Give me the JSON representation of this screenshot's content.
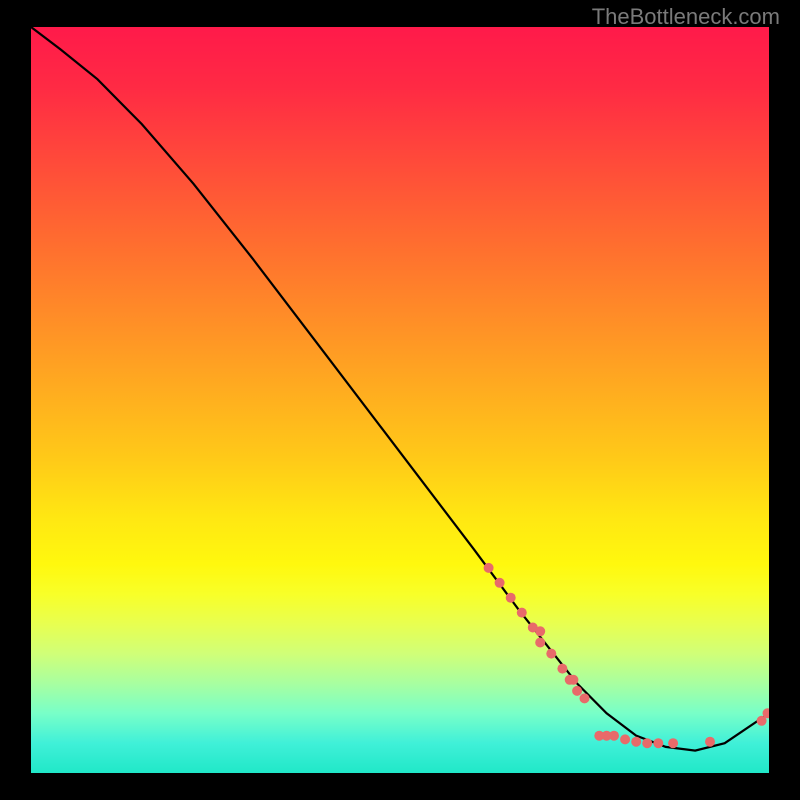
{
  "watermark": "TheBottleneck.com",
  "chart_data": {
    "type": "line",
    "title": "",
    "xlabel": "",
    "ylabel": "",
    "xlim": [
      0,
      100
    ],
    "ylim": [
      0,
      100
    ],
    "grid": false,
    "legend": false,
    "series": [
      {
        "name": "curve",
        "x": [
          0,
          4,
          9,
          15,
          22,
          30,
          40,
          50,
          60,
          66,
          70,
          74,
          78,
          82,
          86,
          90,
          94,
          100
        ],
        "y": [
          100,
          97,
          93,
          87,
          79,
          69,
          56,
          43,
          30,
          22,
          17,
          12,
          8,
          5,
          3.5,
          3,
          4,
          8
        ]
      }
    ],
    "markers": [
      {
        "x": 62.0,
        "y": 27.5
      },
      {
        "x": 63.5,
        "y": 25.5
      },
      {
        "x": 65.0,
        "y": 23.5
      },
      {
        "x": 66.5,
        "y": 21.5
      },
      {
        "x": 68.0,
        "y": 19.5
      },
      {
        "x": 69.0,
        "y": 19.0
      },
      {
        "x": 69.0,
        "y": 17.5
      },
      {
        "x": 70.5,
        "y": 16.0
      },
      {
        "x": 72.0,
        "y": 14.0
      },
      {
        "x": 73.0,
        "y": 12.5
      },
      {
        "x": 73.5,
        "y": 12.5
      },
      {
        "x": 74.0,
        "y": 11.0
      },
      {
        "x": 75.0,
        "y": 10.0
      },
      {
        "x": 77.0,
        "y": 5.0
      },
      {
        "x": 78.0,
        "y": 5.0
      },
      {
        "x": 79.0,
        "y": 5.0
      },
      {
        "x": 80.5,
        "y": 4.5
      },
      {
        "x": 82.0,
        "y": 4.2
      },
      {
        "x": 83.5,
        "y": 4.0
      },
      {
        "x": 85.0,
        "y": 4.0
      },
      {
        "x": 87.0,
        "y": 4.0
      },
      {
        "x": 92.0,
        "y": 4.2
      },
      {
        "x": 99.0,
        "y": 7.0
      },
      {
        "x": 99.8,
        "y": 8.0
      }
    ],
    "background_gradient": {
      "top": "#ff1a4a",
      "mid": "#ffe812",
      "bottom": "#20e8c8"
    }
  }
}
